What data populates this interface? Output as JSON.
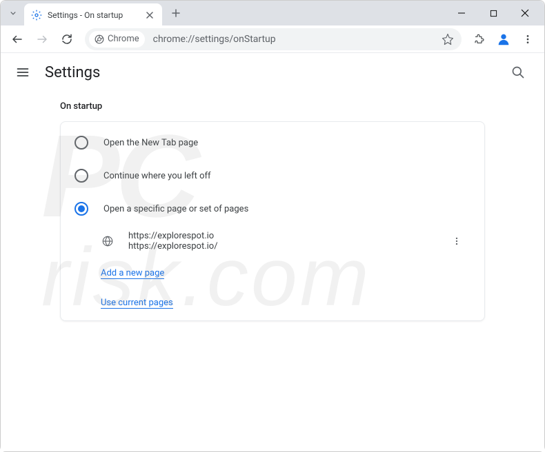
{
  "tab": {
    "title": "Settings - On startup"
  },
  "address": {
    "badge": "Chrome",
    "url": "chrome://settings/onStartup"
  },
  "header": {
    "title": "Settings"
  },
  "section": {
    "title": "On startup"
  },
  "options": {
    "newtab": "Open the New Tab page",
    "continue": "Continue where you left off",
    "specific": "Open a specific page or set of pages"
  },
  "page_entry": {
    "title": "https://explorespot.io",
    "url": "https://explorespot.io/"
  },
  "links": {
    "add": "Add a new page",
    "use_current": "Use current pages"
  }
}
